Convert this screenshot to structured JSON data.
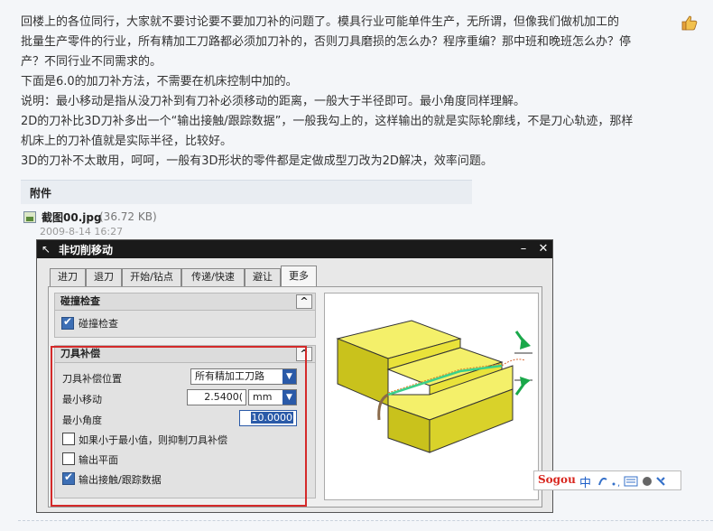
{
  "post": {
    "lines": [
      "回楼上的各位同行，大家就不要讨论要不要加刀补的问题了。模具行业可能单件生产，无所谓，但像我们做机加工的",
      "批量生产零件的行业，所有精加工刀路都必须加刀补的，否则刀具磨损的怎么办？程序重编？那中班和晚班怎么办？停",
      "产？不同行业不同需求的。",
      "下面是6.0的加刀补方法，不需要在机床控制中加的。",
      "说明：最小移动是指从没刀补到有刀补必须移动的距离，一般大于半径即可。最小角度同样理解。",
      "2D的刀补比3D刀补多出一个“输出接触/跟踪数据”，一般我勾上的，这样输出的就是实际轮廓线，不是刀心轨迹，那样",
      "机床上的刀补值就是实际半径，比较好。",
      "3D的刀补不太敢用，呵呵，一般有3D形状的零件都是定做成型刀改为2D解决，效率问题。"
    ]
  },
  "attachment": {
    "title": "附件",
    "file_name": "截图00.jpg",
    "file_size": "(36.72 KB)",
    "date": "2009-8-14 16:27"
  },
  "dialog": {
    "title": "非切削移动",
    "tabs": [
      "进刀",
      "退刀",
      "开始/钻点",
      "传递/快速",
      "避让",
      "更多"
    ],
    "active_tab": "更多",
    "collision": {
      "header": "碰撞检查",
      "checkbox_label": "碰撞检查",
      "checked": true
    },
    "cutter_comp": {
      "header": "刀具补偿",
      "position_label": "刀具补偿位置",
      "position_value": "所有精加工刀路",
      "min_move_label": "最小移动",
      "min_move_value": "2.5400(",
      "min_move_unit": "mm",
      "min_angle_label": "最小角度",
      "min_angle_value": "10.0000",
      "suppress_label": "如果小于最小值，则抑制刀具补偿",
      "suppress_checked": false,
      "output_plane_label": "输出平面",
      "output_plane_checked": false,
      "output_contact_label": "输出接触/跟踪数据",
      "output_contact_checked": true
    }
  },
  "ime": {
    "logo": "Sogou",
    "mode": "中"
  },
  "colors": {
    "highlight_red": "#d42a2a",
    "accent_blue": "#2a5aa8",
    "titlebar": "#1a1a1a"
  }
}
